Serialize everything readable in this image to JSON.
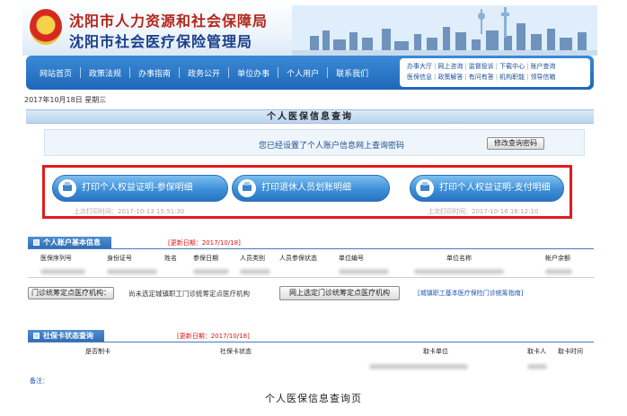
{
  "header": {
    "org_line1": "沈阳市人力资源和社会保障局",
    "org_line2": "沈阳市社会医疗保险管理局",
    "emblem_glyph": "★"
  },
  "nav": {
    "items": [
      "网站首页",
      "政策法规",
      "办事指南",
      "政务公开",
      "单位办事",
      "个人用户",
      "联系我们"
    ],
    "quick_links_row1": [
      "办事大厅",
      "网上咨询",
      "监督投诉",
      "下载中心",
      "账户查询"
    ],
    "quick_links_row2": [
      "医保信息",
      "政策解答",
      "有问有答",
      "机构职能",
      "领导信箱"
    ]
  },
  "date_text": "2017年10月18日 星期三",
  "page_title": "个人医保信息查询",
  "notice": {
    "text": "您已经设置了个人账户信息网上查询密码",
    "button": "修改查询密码"
  },
  "print_buttons": [
    {
      "label": "打印个人权益证明-参保明细"
    },
    {
      "label": "打印退休人员划账明细"
    },
    {
      "label": "打印个人权益证明-支付明细"
    }
  ],
  "print_times": [
    "上次打印时间：2017-10-13 15:51:30",
    "上次打印时间：2017-10-16 16:12:10"
  ],
  "section1": {
    "title": "个人账户基本信息",
    "date": "[更新日期：2017/10/18]",
    "columns": [
      "医保序列号",
      "身份证号",
      "姓名",
      "参保日期",
      "人员类别",
      "人员参保状态",
      "单位编号",
      "单位名称",
      "帐户余额"
    ]
  },
  "clinic": {
    "label": "门诊统筹定点医疗机构：",
    "text": "尚未选定城镇职工门诊统筹定点医疗机构",
    "button": "网上选定门诊统筹定点医疗机构",
    "link": "[城镇职工基本医疗保险门诊统筹指南]"
  },
  "section2": {
    "title": "社保卡状态查询",
    "date": "[更新日期：2017/10/18]",
    "columns": [
      "是否制卡",
      "社保卡状态",
      "取卡单位",
      "取卡人",
      "取卡时间"
    ]
  },
  "memo": "备注：",
  "caption": "个人医保信息查询页",
  "colors": {
    "nav_blue": "#1f67b8",
    "highlight_red": "#e11b1b",
    "update_date_red": "#dd1111",
    "link_blue": "#1a56b0"
  }
}
